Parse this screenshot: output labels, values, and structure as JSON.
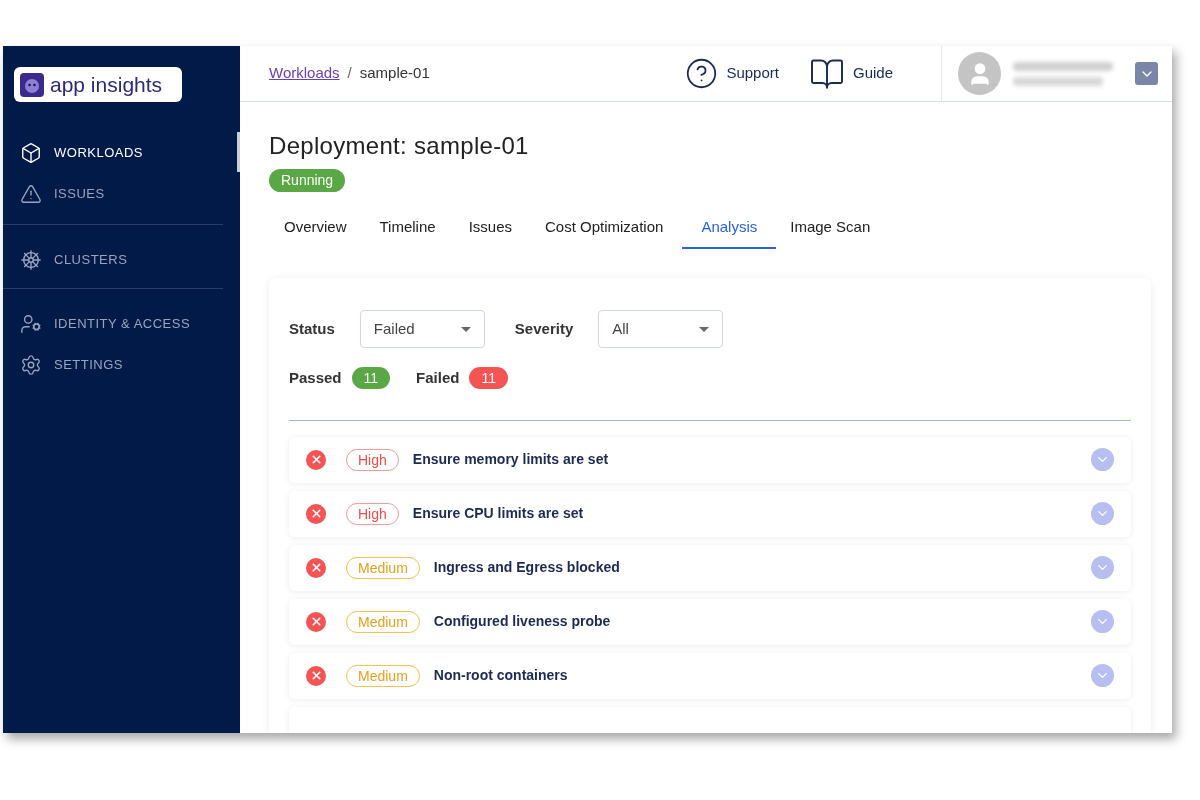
{
  "logo": {
    "text": "app insights"
  },
  "sidebar": {
    "groups": [
      {
        "items": [
          {
            "label": "WORKLOADS",
            "selected": true
          },
          {
            "label": "ISSUES",
            "selected": false
          }
        ]
      },
      {
        "items": [
          {
            "label": "CLUSTERS",
            "selected": false
          }
        ]
      },
      {
        "items": [
          {
            "label": "IDENTITY & ACCESS",
            "selected": false
          },
          {
            "label": "SETTINGS",
            "selected": false
          }
        ]
      }
    ]
  },
  "breadcrumb": {
    "link": "Workloads",
    "separator": "/",
    "current": "sample-01"
  },
  "header_links": [
    {
      "label": "Support"
    },
    {
      "label": "Guide"
    }
  ],
  "title": "Deployment: sample-01",
  "status_badge": "Running",
  "tabs": [
    {
      "label": "Overview",
      "selected": false
    },
    {
      "label": "Timeline",
      "selected": false
    },
    {
      "label": "Issues",
      "selected": false
    },
    {
      "label": "Cost Optimization",
      "selected": false
    },
    {
      "label": "Analysis",
      "selected": true
    },
    {
      "label": "Image Scan",
      "selected": false
    }
  ],
  "filters": [
    {
      "label": "Status",
      "value": "Failed"
    },
    {
      "label": "Severity",
      "value": "All"
    }
  ],
  "counts": [
    {
      "label": "Passed",
      "count": "11",
      "color": "#5aa845"
    },
    {
      "label": "Failed",
      "count": "11",
      "color": "#f55454"
    }
  ],
  "checks": [
    {
      "passed": false,
      "severity": "High",
      "kind": "high",
      "title": "Ensure memory limits are set"
    },
    {
      "passed": false,
      "severity": "High",
      "kind": "high",
      "title": "Ensure CPU limits are set"
    },
    {
      "passed": false,
      "severity": "Medium",
      "kind": "medium",
      "title": "Ingress and Egress blocked"
    },
    {
      "passed": false,
      "severity": "Medium",
      "kind": "medium",
      "title": "Configured liveness probe"
    },
    {
      "passed": false,
      "severity": "Medium",
      "kind": "medium",
      "title": "Non-root containers"
    }
  ]
}
